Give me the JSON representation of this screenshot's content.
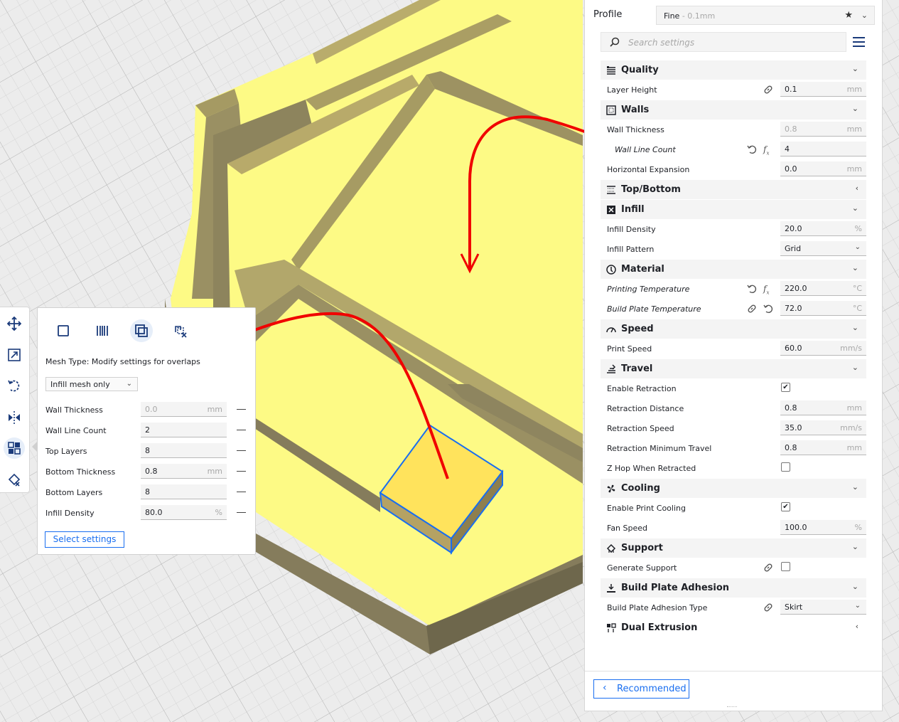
{
  "viewport": {
    "model_color": "#fdfa85",
    "wall_color": "#b5a86a",
    "selection_color": "#196ef0"
  },
  "toolbar": {
    "tools": [
      "move-tool-icon",
      "scale-tool-icon",
      "rotate-tool-icon",
      "mirror-tool-icon",
      "per-model-settings-icon",
      "support-blocker-icon"
    ]
  },
  "per_model": {
    "mesh_type_label": "Mesh Type: Modify settings for overlaps",
    "mesh_type_select": "Infill mesh only",
    "rows": [
      {
        "label": "Wall Thickness",
        "value": "0.0",
        "unit": "mm"
      },
      {
        "label": "Wall Line Count",
        "value": "2",
        "unit": ""
      },
      {
        "label": "Top Layers",
        "value": "8",
        "unit": ""
      },
      {
        "label": "Bottom Thickness",
        "value": "0.8",
        "unit": "mm"
      },
      {
        "label": "Bottom Layers",
        "value": "8",
        "unit": ""
      },
      {
        "label": "Infill Density",
        "value": "80.0",
        "unit": "%"
      }
    ],
    "select_button": "Select settings"
  },
  "settings": {
    "profile_label": "Profile",
    "profile_name": "Fine",
    "profile_sub": " - 0.1mm",
    "search_placeholder": "Search settings",
    "quality": {
      "title": "Quality",
      "layer_height": {
        "label": "Layer Height",
        "value": "0.1",
        "unit": "mm"
      }
    },
    "walls": {
      "title": "Walls",
      "wall_thickness": {
        "label": "Wall Thickness",
        "value": "0.8",
        "unit": "mm"
      },
      "wall_line_count": {
        "label": "Wall Line Count",
        "value": "4"
      },
      "horizontal_expansion": {
        "label": "Horizontal Expansion",
        "value": "0.0",
        "unit": "mm"
      }
    },
    "top_bottom": {
      "title": "Top/Bottom"
    },
    "infill": {
      "title": "Infill",
      "density": {
        "label": "Infill Density",
        "value": "20.0",
        "unit": "%"
      },
      "pattern": {
        "label": "Infill Pattern",
        "value": "Grid"
      }
    },
    "material": {
      "title": "Material",
      "print_temp": {
        "label": "Printing Temperature",
        "value": "220.0",
        "unit": "°C"
      },
      "bed_temp": {
        "label": "Build Plate Temperature",
        "value": "72.0",
        "unit": "°C"
      }
    },
    "speed": {
      "title": "Speed",
      "print_speed": {
        "label": "Print Speed",
        "value": "60.0",
        "unit": "mm/s"
      }
    },
    "travel": {
      "title": "Travel",
      "enable_retraction": {
        "label": "Enable Retraction",
        "checked": true
      },
      "retraction_distance": {
        "label": "Retraction Distance",
        "value": "0.8",
        "unit": "mm"
      },
      "retraction_speed": {
        "label": "Retraction Speed",
        "value": "35.0",
        "unit": "mm/s"
      },
      "retraction_min_travel": {
        "label": "Retraction Minimum Travel",
        "value": "0.8",
        "unit": "mm"
      },
      "z_hop": {
        "label": "Z Hop When Retracted",
        "checked": false
      }
    },
    "cooling": {
      "title": "Cooling",
      "enable_cooling": {
        "label": "Enable Print Cooling",
        "checked": true
      },
      "fan_speed": {
        "label": "Fan Speed",
        "value": "100.0",
        "unit": "%"
      }
    },
    "support": {
      "title": "Support",
      "generate_support": {
        "label": "Generate Support",
        "checked": false
      }
    },
    "adhesion": {
      "title": "Build Plate Adhesion",
      "type": {
        "label": "Build Plate Adhesion Type",
        "value": "Skirt"
      }
    },
    "dual": {
      "title": "Dual Extrusion"
    },
    "recommended_button": "Recommended"
  }
}
